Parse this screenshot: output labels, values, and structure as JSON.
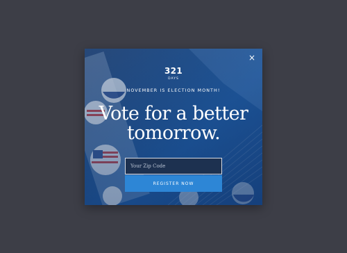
{
  "modal": {
    "close_label": "×",
    "countdown": {
      "number": "321",
      "unit": "DAYS"
    },
    "eyebrow": "NOVEMBER IS ELECTION MONTH!",
    "headline_line1": "Vote for a better",
    "headline_line2": "tomorrow.",
    "zip_input": {
      "placeholder": "Your Zip Code",
      "value": ""
    },
    "register_button_label": "REGISTER NOW"
  },
  "colors": {
    "page_background": "#3d3e47",
    "modal_blue": "#1f5aa0",
    "button_blue": "#2d86d6",
    "input_background": "#1d3150"
  }
}
